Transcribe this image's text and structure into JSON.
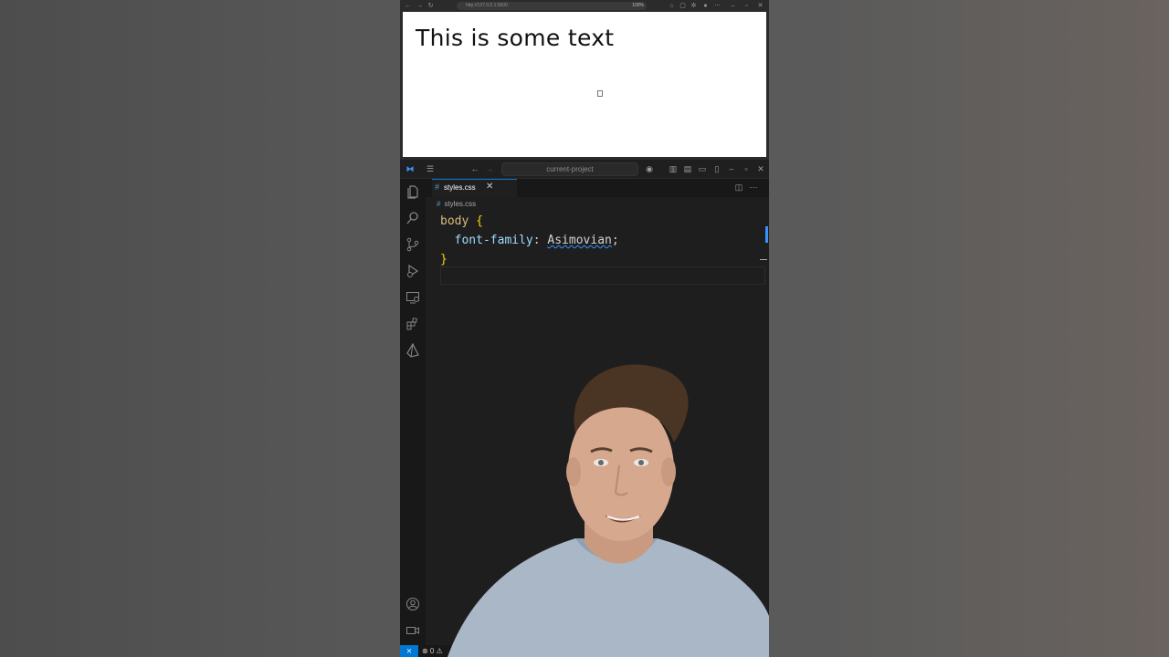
{
  "browser": {
    "url": "http://127.0.0.1:5500",
    "zoom": "100%",
    "page_heading": "This is some text"
  },
  "vscode": {
    "search_placeholder": "current-project",
    "tab": {
      "icon": "#",
      "label": "styles.css",
      "close": "✕"
    },
    "breadcrumb": {
      "icon": "#",
      "label": "styles.css"
    },
    "code": {
      "selector": "body",
      "open_brace": "{",
      "property": "font-family",
      "colon": ":",
      "value": "Asimovian",
      "semicolon": ";",
      "close_brace": "}"
    },
    "status": {
      "remote_icon": "⨯",
      "problems": "⊗ 0 ⚠"
    }
  },
  "colors": {
    "accent": "#0078d4",
    "editor_bg": "#1e1e1e",
    "selector": "#d7ba7d",
    "property": "#9cdcfe",
    "brace": "#ffd700"
  },
  "icons": [
    "explorer-icon",
    "search-icon",
    "source-control-icon",
    "run-debug-icon",
    "remote-explorer-icon",
    "extensions-icon",
    "prisma-icon",
    "account-icon",
    "camera-icon"
  ]
}
